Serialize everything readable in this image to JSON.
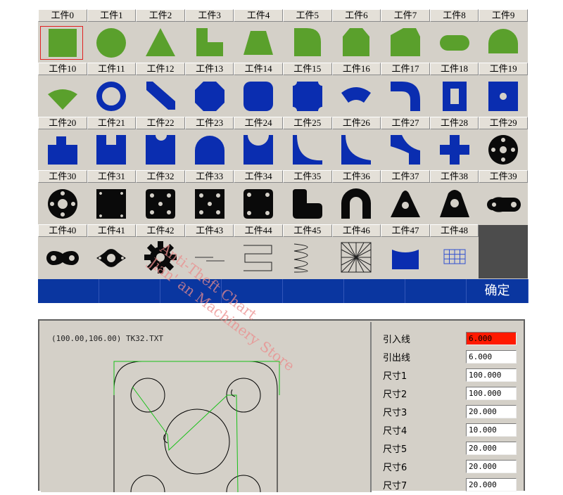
{
  "library": {
    "items": [
      {
        "label": "工件0",
        "icon": "square-shape-icon"
      },
      {
        "label": "工件1",
        "icon": "circle-shape-icon"
      },
      {
        "label": "工件2",
        "icon": "triangle-shape-icon"
      },
      {
        "label": "工件3",
        "icon": "l-shape-icon"
      },
      {
        "label": "工件4",
        "icon": "trapezoid-shape-icon"
      },
      {
        "label": "工件5",
        "icon": "rounded-corner-shape-icon"
      },
      {
        "label": "工件6",
        "icon": "chamfered-pentagon-shape-icon"
      },
      {
        "label": "工件7",
        "icon": "hexagon-shape-icon"
      },
      {
        "label": "工件8",
        "icon": "stadium-shape-icon"
      },
      {
        "label": "工件9",
        "icon": "dome-shape-icon"
      },
      {
        "label": "工件10",
        "icon": "fan-sector-shape-icon"
      },
      {
        "label": "工件11",
        "icon": "ring-shape-icon"
      },
      {
        "label": "工件12",
        "icon": "beveled-strip-shape-icon"
      },
      {
        "label": "工件13",
        "icon": "octagon-shape-icon"
      },
      {
        "label": "工件14",
        "icon": "rounded-square-shape-icon"
      },
      {
        "label": "工件15",
        "icon": "concave-corner-square-shape-icon"
      },
      {
        "label": "工件16",
        "icon": "arc-sector-shape-icon"
      },
      {
        "label": "工件17",
        "icon": "curved-elbow-shape-icon"
      },
      {
        "label": "工件18",
        "icon": "rect-slot-plate-shape-icon"
      },
      {
        "label": "工件19",
        "icon": "square-hole-plate-shape-icon"
      },
      {
        "label": "工件20",
        "icon": "tab-block-shape-icon"
      },
      {
        "label": "工件21",
        "icon": "notched-block-shape-icon"
      },
      {
        "label": "工件22",
        "icon": "round-notch-block-shape-icon"
      },
      {
        "label": "工件23",
        "icon": "arch-shape-icon"
      },
      {
        "label": "工件24",
        "icon": "saddle-shape-icon"
      },
      {
        "label": "工件25",
        "icon": "concave-arc-shape-icon"
      },
      {
        "label": "工件26",
        "icon": "quarter-fillet-shape-icon"
      },
      {
        "label": "工件27",
        "icon": "curved-step-shape-icon"
      },
      {
        "label": "工件28",
        "icon": "cross-shape-icon"
      },
      {
        "label": "工件29",
        "icon": "flange-disc-icon"
      },
      {
        "label": "工件30",
        "icon": "bolt-circle-flange-icon"
      },
      {
        "label": "工件31",
        "icon": "four-hole-plate-icon"
      },
      {
        "label": "工件32",
        "icon": "five-hole-plate-icon"
      },
      {
        "label": "工件33",
        "icon": "center-hole-plate-icon"
      },
      {
        "label": "工件34",
        "icon": "four-hole-rounded-plate-icon"
      },
      {
        "label": "工件35",
        "icon": "l-bracket-icon"
      },
      {
        "label": "工件36",
        "icon": "u-shape-icon"
      },
      {
        "label": "工件37",
        "icon": "triangular-lug-icon"
      },
      {
        "label": "工件38",
        "icon": "lifting-lug-icon"
      },
      {
        "label": "工件39",
        "icon": "link-lug-icon"
      },
      {
        "label": "工件40",
        "icon": "two-hole-link-icon"
      },
      {
        "label": "工件41",
        "icon": "oval-flange-icon"
      },
      {
        "label": "工件42",
        "icon": "gear-icon"
      },
      {
        "label": "工件43",
        "icon": "thin-lines-icon"
      },
      {
        "label": "工件44",
        "icon": "zigzag-path-icon"
      },
      {
        "label": "工件45",
        "icon": "wave-path-icon"
      },
      {
        "label": "工件46",
        "icon": "grid-mesh-icon"
      },
      {
        "label": "工件47",
        "icon": "v-notch-shape-icon"
      },
      {
        "label": "工件48",
        "icon": "blue-grid-icon"
      }
    ],
    "selected_index": 0,
    "confirm_label": "确定"
  },
  "editor": {
    "coordinate_readout": "(100.00,106.00) TK32.TXT",
    "params": [
      {
        "label": "引入线",
        "value": "6.000",
        "active": true
      },
      {
        "label": "引出线",
        "value": "6.000",
        "active": false
      },
      {
        "label": "尺寸1",
        "value": "100.000",
        "active": false
      },
      {
        "label": "尺寸2",
        "value": "100.000",
        "active": false
      },
      {
        "label": "尺寸3",
        "value": "20.000",
        "active": false
      },
      {
        "label": "尺寸4",
        "value": "10.000",
        "active": false
      },
      {
        "label": "尺寸5",
        "value": "20.000",
        "active": false
      },
      {
        "label": "尺寸6",
        "value": "20.000",
        "active": false
      },
      {
        "label": "尺寸7",
        "value": "20.000",
        "active": false
      }
    ]
  },
  "watermark": {
    "line1": "Anti-Theft Chart",
    "line2": "Jian' an Machinery Store"
  },
  "colors": {
    "green": "#5aa02c",
    "blue": "#0a2db0",
    "black": "#0a0a0a",
    "panel": "#d4d0c8",
    "toolbar": "#0a36a0",
    "active_input": "#ff1a00"
  }
}
